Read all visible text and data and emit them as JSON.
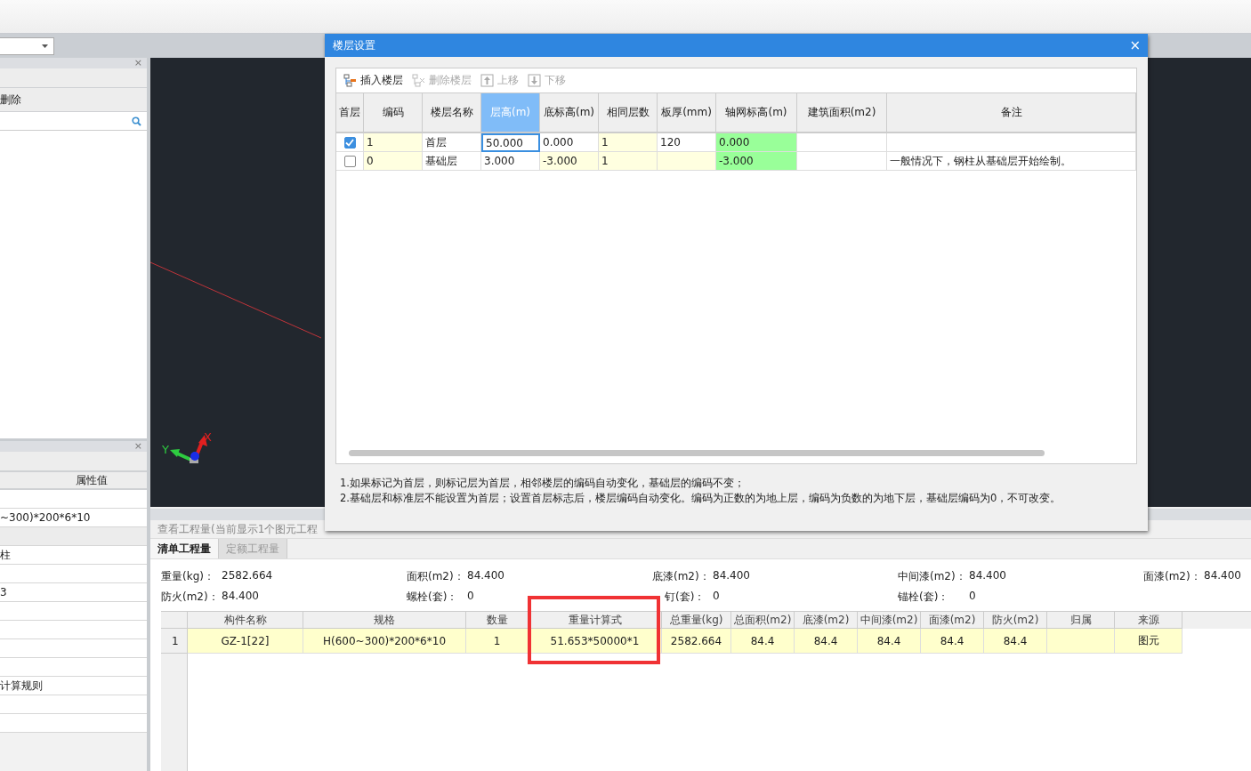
{
  "left_panel": {
    "close_glyphs": [
      "×",
      "×"
    ],
    "toolbar_label": "删除",
    "properties": {
      "header": "属性值",
      "rows": [
        {
          "kind": "row"
        },
        {
          "kind": "row",
          "text": "~300)*200*6*10"
        },
        {
          "kind": "group"
        },
        {
          "kind": "row",
          "text": "柱"
        },
        {
          "kind": "row"
        },
        {
          "kind": "row",
          "text": "3"
        },
        {
          "kind": "row"
        },
        {
          "kind": "row"
        },
        {
          "kind": "row"
        },
        {
          "kind": "row"
        },
        {
          "kind": "row",
          "text": "计算规则"
        },
        {
          "kind": "row"
        },
        {
          "kind": "row"
        }
      ]
    }
  },
  "canvas": {
    "axis_labels": [
      "Y",
      "X"
    ]
  },
  "quantities": {
    "title": "查看工程量(当前显示1个图元工程",
    "tabs": [
      {
        "label": "清单工程量",
        "selected": true
      },
      {
        "label": "定额工程量",
        "selected": false
      }
    ],
    "summary": [
      [
        {
          "label": "重量(kg)：",
          "value": "2582.664"
        },
        {
          "label": "面积(m2)：",
          "value": "84.400"
        },
        {
          "label": "底漆(m2)：",
          "value": "84.400"
        },
        {
          "label": "中间漆(m2)：",
          "value": "84.400"
        },
        {
          "label": "面漆(m2)：",
          "value": "84.400"
        }
      ],
      [
        {
          "label": "防火(m2)：",
          "value": "84.400"
        },
        {
          "label": "螺栓(套)：",
          "value": "0"
        },
        {
          "label": "钉(套)：",
          "value": "0"
        },
        {
          "label": "锚栓(套)：",
          "value": "0"
        }
      ]
    ],
    "table": {
      "columns": [
        "构件名称",
        "规格",
        "数量",
        "重量计算式",
        "总重量(kg)",
        "总面积(m2)",
        "底漆(m2)",
        "中间漆(m2)",
        "面漆(m2)",
        "防火(m2)",
        "归属",
        "来源"
      ],
      "rows": [
        {
          "number": "1",
          "cells": [
            "GZ-1[22]",
            "H(600~300)*200*6*10",
            "1",
            "51.653*50000*1",
            "2582.664",
            "84.4",
            "84.4",
            "84.4",
            "84.4",
            "84.4",
            "",
            "图元"
          ]
        }
      ]
    }
  },
  "dialog": {
    "title": "楼层设置",
    "close": "×",
    "toolbar": [
      {
        "label": "插入楼层",
        "kind": "insert",
        "disabled": false
      },
      {
        "label": "删除楼层",
        "kind": "delete",
        "disabled": true
      },
      {
        "label": "上移",
        "kind": "up",
        "disabled": true
      },
      {
        "label": "下移",
        "kind": "down",
        "disabled": true
      }
    ],
    "columns": [
      {
        "label": "首层",
        "selected": false
      },
      {
        "label": "编码",
        "selected": false
      },
      {
        "label": "楼层名称",
        "selected": false
      },
      {
        "label": "层高(m)",
        "selected": true
      },
      {
        "label": "底标高(m)",
        "selected": false
      },
      {
        "label": "相同层数",
        "selected": false
      },
      {
        "label": "板厚(mm)",
        "selected": false
      },
      {
        "label": "轴网标高(m)",
        "selected": false
      },
      {
        "label": "建筑面积(m2)",
        "selected": false
      },
      {
        "label": "备注",
        "selected": false
      }
    ],
    "rows": [
      {
        "selected": true,
        "cells": [
          {
            "kind": "checkbox",
            "checked": true
          },
          {
            "text": "1",
            "kind": "locked"
          },
          {
            "text": "首层",
            "kind": "edit"
          },
          {
            "text": "50.000",
            "kind": "edit"
          },
          {
            "text": "0.000",
            "kind": "edit"
          },
          {
            "text": "1",
            "kind": "locked"
          },
          {
            "text": "120",
            "kind": "edit"
          },
          {
            "text": "0.000",
            "kind": "axis"
          },
          {
            "text": "",
            "kind": "edit"
          },
          {
            "text": "",
            "kind": "edit"
          }
        ]
      },
      {
        "selected": false,
        "cells": [
          {
            "kind": "checkbox",
            "checked": false
          },
          {
            "text": "0",
            "kind": "locked"
          },
          {
            "text": "基础层",
            "kind": "edit"
          },
          {
            "text": "3.000",
            "kind": "edit"
          },
          {
            "text": "-3.000",
            "kind": "locked"
          },
          {
            "text": "1",
            "kind": "locked"
          },
          {
            "text": "",
            "kind": "locked"
          },
          {
            "text": "-3.000",
            "kind": "axis"
          },
          {
            "text": "",
            "kind": "edit"
          },
          {
            "text": "一般情况下，钢柱从基础层开始绘制。",
            "kind": "edit"
          }
        ]
      }
    ],
    "notes": [
      "1.如果标记为首层，则标记层为首层，相邻楼层的编码自动变化，基础层的编码不变；",
      "2.基础层和标准层不能设置为首层；设置首层标志后，楼层编码自动变化。编码为正数的为地上层，编码为负数的为地下层，基础层编码为0，不可改变。"
    ]
  }
}
